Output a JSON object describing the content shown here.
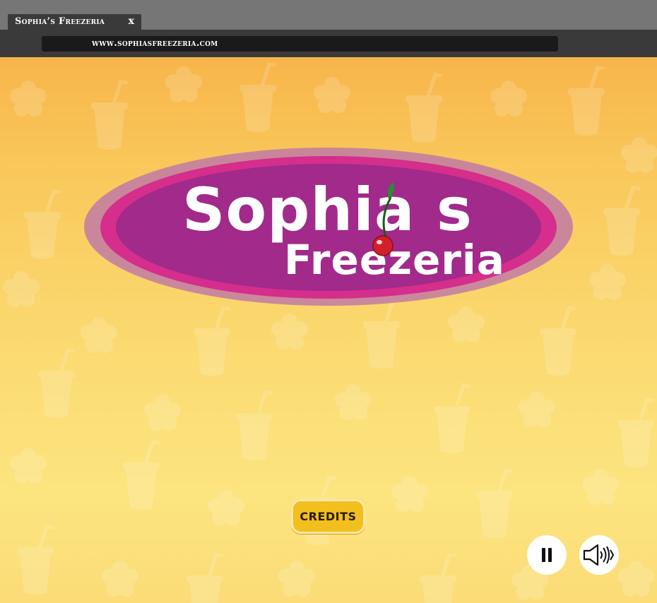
{
  "browser": {
    "tab_title": "Sophia’s Freezeria",
    "tab_close": "x",
    "url": "www.sophiasfreezeria.com"
  },
  "game": {
    "logo": {
      "line1": "Sophia s",
      "line2": "Freezeria"
    },
    "credits_label": "CREDITS",
    "controls": {
      "pause_icon": "pause-icon",
      "sound_icon": "speaker-icon"
    },
    "colors": {
      "background_top": "#f7b54a",
      "background_bottom": "#fce47f",
      "logo_purple": "#a12a8a",
      "logo_pink": "#d52e8c",
      "button_yellow": "#f2bf1f"
    }
  }
}
